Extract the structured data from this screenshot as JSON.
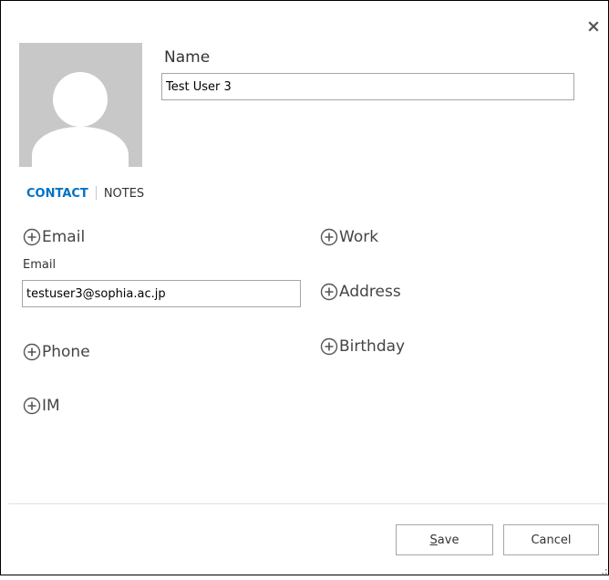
{
  "dialog": {
    "close_icon": "close-icon",
    "avatar_icon": "person-silhouette-icon"
  },
  "name": {
    "label": "Name",
    "value": "Test User 3"
  },
  "tabs": [
    {
      "label": "CONTACT",
      "active": true
    },
    {
      "label": "NOTES",
      "active": false
    }
  ],
  "fields": {
    "email": {
      "add_label": "Email",
      "field_label": "Email",
      "value": "testuser3@sophia.ac.jp"
    },
    "phone": {
      "add_label": "Phone"
    },
    "im": {
      "add_label": "IM"
    },
    "work": {
      "add_label": "Work"
    },
    "address": {
      "add_label": "Address"
    },
    "birthday": {
      "add_label": "Birthday"
    }
  },
  "footer": {
    "save_accel": "S",
    "save_rest": "ave",
    "cancel_label": "Cancel"
  },
  "colors": {
    "accent": "#0072c6",
    "avatar_bg": "#c8c8c8",
    "border": "#a6a6a6"
  }
}
